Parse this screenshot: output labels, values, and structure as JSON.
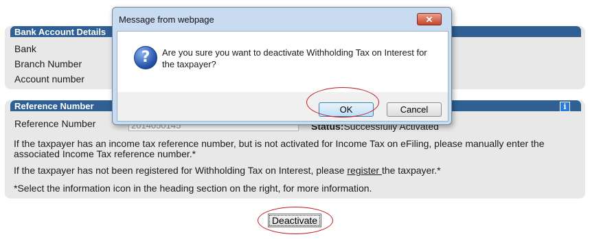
{
  "bank_panel": {
    "title": "Bank Account Details",
    "rows": [
      "Bank",
      "Branch Number",
      "Account number"
    ]
  },
  "reference_panel": {
    "title": "Reference Number",
    "row_label": "Reference Number",
    "input_value": "2014050145",
    "status_label": "Status:",
    "status_value": "Successfully Activated",
    "info_icon": "info-icon",
    "para1": "If the taxpayer has an income tax reference number, but is not activated for Income Tax on eFiling, please manually enter the associated Income Tax reference number.*",
    "para2_before": "If the taxpayer has not been registered for Withholding Tax on Interest, please ",
    "para2_link": "register ",
    "para2_after": "the taxpayer.*",
    "para3": "*Select the information icon in the heading section on the right, for more information."
  },
  "deactivate_button": "Deactivate",
  "dialog": {
    "title": "Message from webpage",
    "close_label": "✕",
    "icon": "question-icon",
    "message": "Are you sure you want to deactivate Withholding Tax on Interest for the taxpayer?",
    "ok_label": "OK",
    "cancel_label": "Cancel"
  },
  "colors": {
    "header": "#2f5f93",
    "panel": "#e8e8e8",
    "annotation": "#c4161c"
  }
}
